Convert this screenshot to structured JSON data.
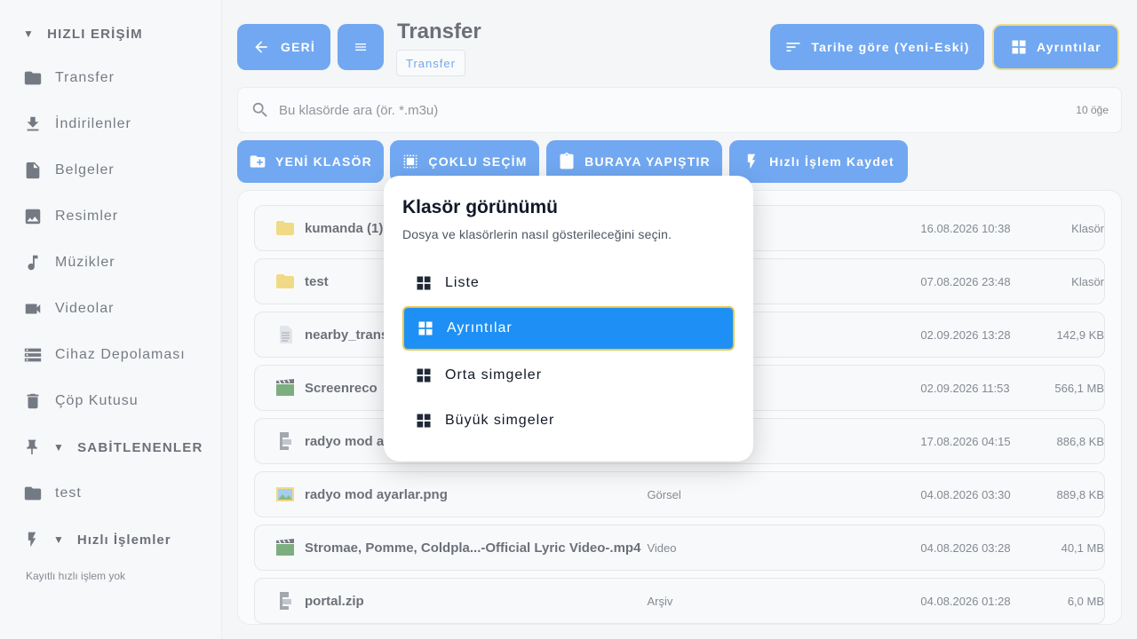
{
  "sidebar": {
    "quick_access": "HIZLI ERİŞİM",
    "items": [
      {
        "label": "Transfer",
        "icon": "folder-icon"
      },
      {
        "label": "İndirilenler",
        "icon": "download-icon"
      },
      {
        "label": "Belgeler",
        "icon": "document-icon"
      },
      {
        "label": "Resimler",
        "icon": "image-icon"
      },
      {
        "label": "Müzikler",
        "icon": "music-icon"
      },
      {
        "label": "Videolar",
        "icon": "video-icon"
      },
      {
        "label": "Cihaz Depolaması",
        "icon": "storage-icon"
      },
      {
        "label": "Çöp Kutusu",
        "icon": "trash-icon"
      }
    ],
    "pinned": "SABİTLENENLER",
    "pinned_items": [
      {
        "label": "test",
        "icon": "folder-icon"
      }
    ],
    "quick_actions": "Hızlı İşlemler",
    "quick_actions_empty": "Kayıtlı hızlı işlem yok"
  },
  "toolbar": {
    "back": "GERİ",
    "title": "Transfer",
    "breadcrumb": "Transfer",
    "sort": "Tarihe göre (Yeni-Eski)",
    "view": "Ayrıntılar"
  },
  "search": {
    "placeholder": "Bu klasörde ara (ör. *.m3u)",
    "count": "10 öğe"
  },
  "actions": {
    "new_folder": "YENİ KLASÖR",
    "multi_select": "ÇOKLU SEÇİM",
    "paste": "BURAYA YAPIŞTIR",
    "save_quick": "Hızlı İşlem Kaydet"
  },
  "files": [
    {
      "name": "kumanda (1)",
      "type": "",
      "date": "16.08.2026 10:38",
      "size": "Klasör",
      "icon": "folder-icon"
    },
    {
      "name": "test",
      "type": "",
      "date": "07.08.2026 23:48",
      "size": "Klasör",
      "icon": "folder-icon"
    },
    {
      "name": "nearby_trans",
      "type": "",
      "date": "02.09.2026 13:28",
      "size": "142,9 KB",
      "icon": "text-file-icon"
    },
    {
      "name": "Screenreco",
      "type": "",
      "date": "02.09.2026 11:53",
      "size": "566,1 MB",
      "icon": "video-file-icon"
    },
    {
      "name": "radyo mod a",
      "type": "",
      "date": "17.08.2026 04:15",
      "size": "886,8 KB",
      "icon": "archive-file-icon"
    },
    {
      "name": "radyo mod ayarlar.png",
      "type": "Görsel",
      "date": "04.08.2026 03:30",
      "size": "889,8 KB",
      "icon": "image-file-icon"
    },
    {
      "name": "Stromae, Pomme, Coldpla...-Official Lyric Video-.mp4",
      "type": "Video",
      "date": "04.08.2026 03:28",
      "size": "40,1 MB",
      "icon": "video-file-icon"
    },
    {
      "name": "portal.zip",
      "type": "Arşiv",
      "date": "04.08.2026 01:28",
      "size": "6,0 MB",
      "icon": "archive-file-icon"
    }
  ],
  "dialog": {
    "title": "Klasör görünümü",
    "subtitle": "Dosya ve klasörlerin nasıl gösterileceğini seçin.",
    "options": [
      {
        "label": "Liste",
        "selected": false
      },
      {
        "label": "Ayrıntılar",
        "selected": true
      },
      {
        "label": "Orta simgeler",
        "selected": false
      },
      {
        "label": "Büyük simgeler",
        "selected": false
      }
    ]
  },
  "colors": {
    "accent": "#1a73e8",
    "selected_option": "#1e90f5",
    "focus_border": "#e6c84a"
  }
}
